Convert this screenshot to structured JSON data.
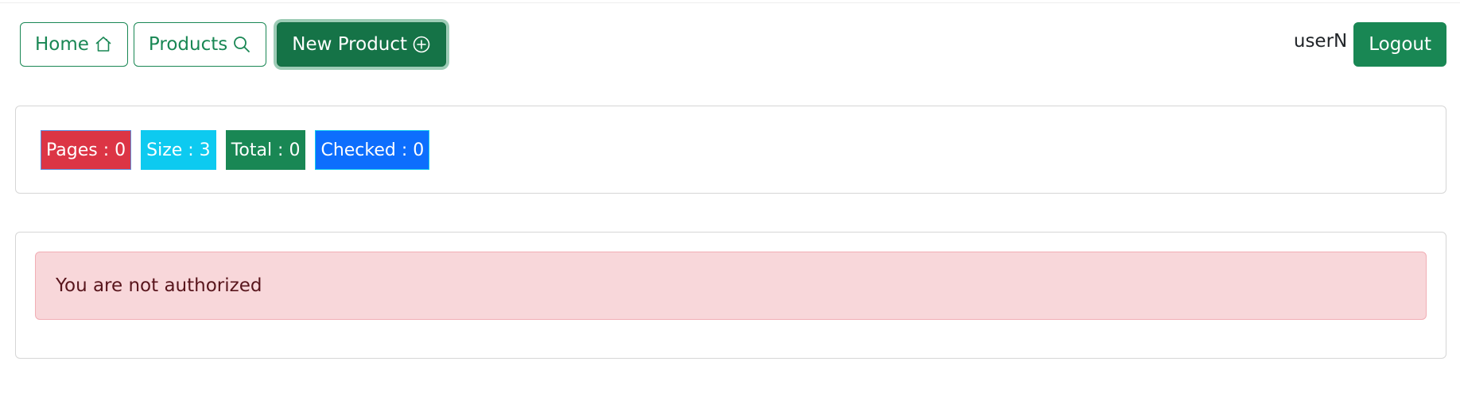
{
  "nav": {
    "home_label": "Home",
    "products_label": "Products",
    "new_product_label": "New Product",
    "username": "userN",
    "logout_label": "Logout"
  },
  "icons": {
    "home": "home-icon",
    "products": "search-icon",
    "new_product": "plus-circle-icon"
  },
  "stats": {
    "pages": "Pages : 0",
    "size": "Size : 3",
    "total": "Total : 0",
    "checked": "Checked : 0"
  },
  "alert": {
    "message": "You are not authorized"
  },
  "colors": {
    "primary_green": "#198754",
    "danger": "#dc3545",
    "info": "#0dcaf0",
    "primary_blue": "#0d6efd",
    "alert_bg": "#f8d7da",
    "alert_text": "#58151c"
  }
}
